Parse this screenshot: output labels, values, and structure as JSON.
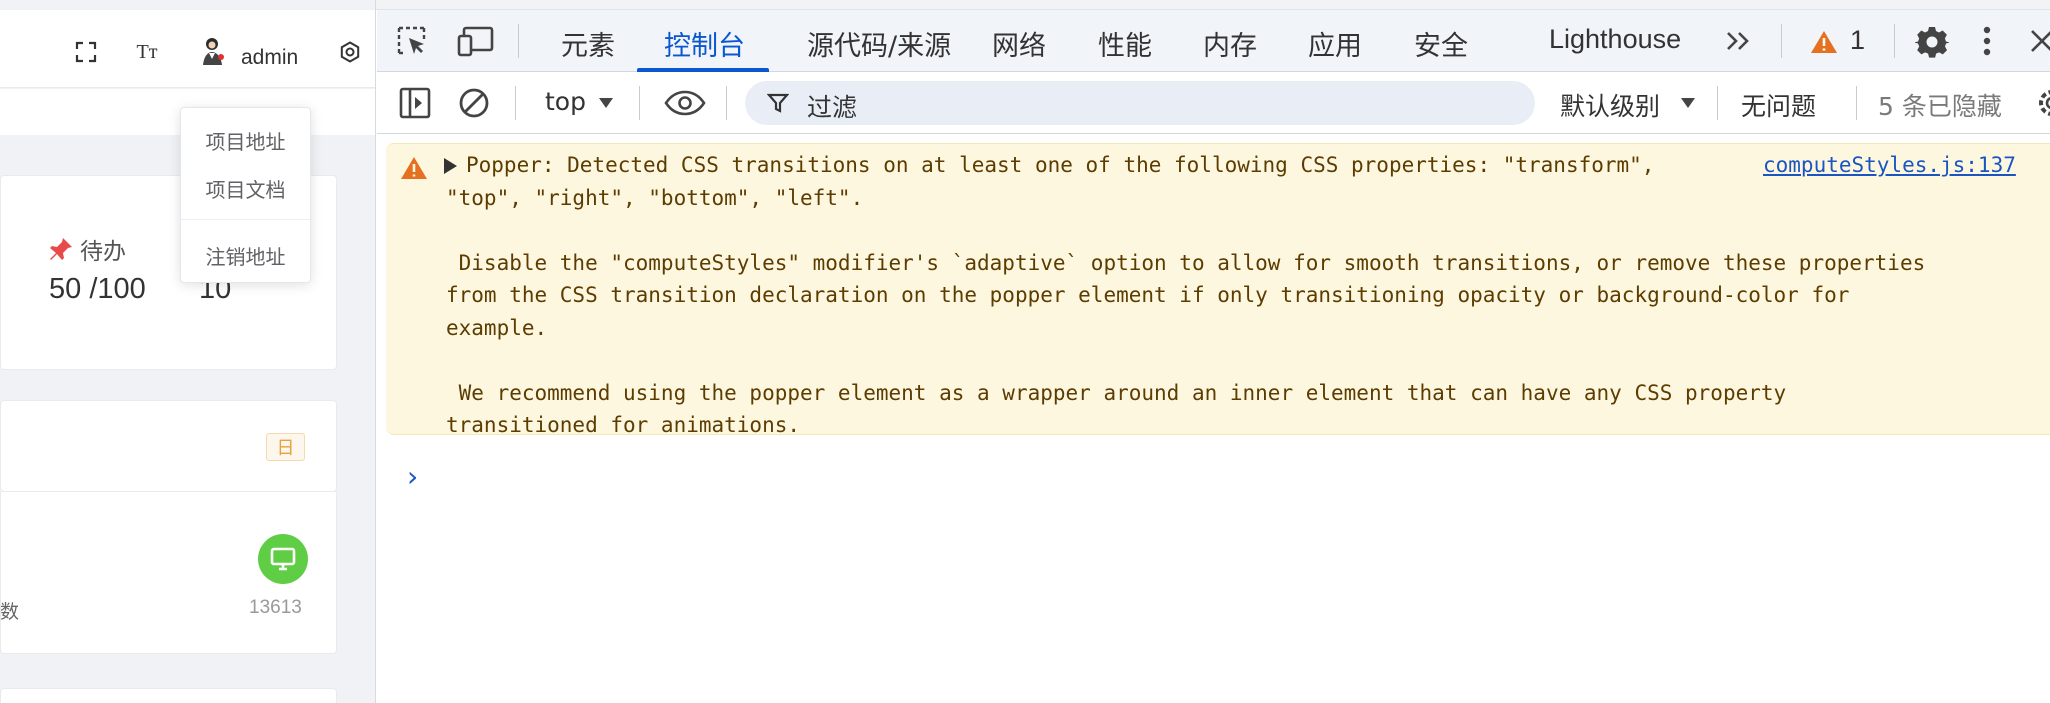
{
  "app_header": {
    "user_name": "admin",
    "icons": [
      "fullscreen-icon",
      "font-size-icon",
      "avatar",
      "settings-icon"
    ]
  },
  "user_dropdown": {
    "items": [
      "项目地址",
      "项目文档",
      "注销地址"
    ]
  },
  "dashboard": {
    "todo_label": "待办",
    "todo_value": "50 /100",
    "second_value": "10",
    "day_badge": "日",
    "partial_label": "数",
    "visitor_count": "13613"
  },
  "devtools": {
    "tabs": [
      "元素",
      "控制台",
      "源代码/来源",
      "网络",
      "性能",
      "内存",
      "应用",
      "安全",
      "Lighthouse"
    ],
    "active_tab": "控制台",
    "warning_count": "1",
    "context_selector": "top",
    "filter_placeholder": "过滤",
    "log_level": "默认级别",
    "issues": "无问题",
    "hidden_count": "5 条已隐藏",
    "console_messages": [
      {
        "level": "warning",
        "lines": [
          "Popper: Detected CSS transitions on at least one of the following CSS properties: \"transform\",",
          "\"top\", \"right\", \"bottom\", \"left\".",
          "",
          " Disable the \"computeStyles\" modifier's `adaptive` option to allow for smooth transitions, or remove these properties",
          "from the CSS transition declaration on the popper element if only transitioning opacity or background-color for",
          "example.",
          "",
          " We recommend using the popper element as a wrapper around an inner element that can have any CSS property",
          "transitioned for animations."
        ],
        "source": "computeStyles.js:137"
      }
    ],
    "prompt_symbol": "›"
  }
}
